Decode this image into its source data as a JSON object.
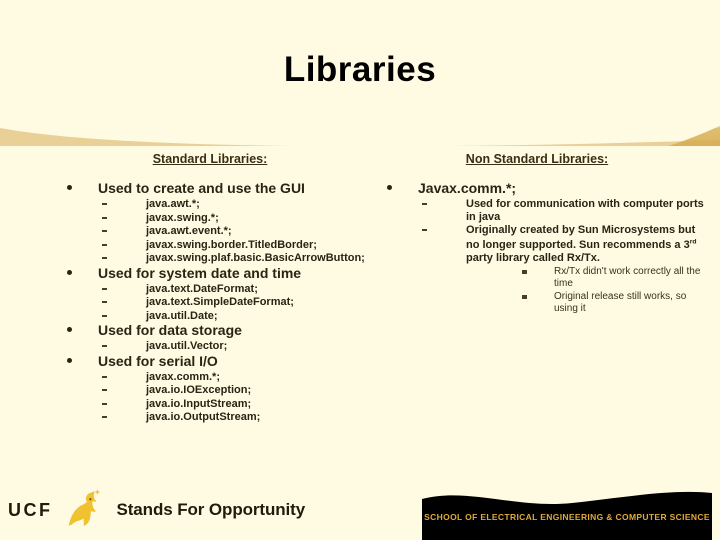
{
  "slide": {
    "title": "Libraries",
    "background_color": "#FFFBE2",
    "title_color": "#000000",
    "accent_gold": "#E8C772"
  },
  "left_column": {
    "heading": "Standard Libraries:",
    "bullets": [
      {
        "text": "Used to create and use the GUI",
        "sub": [
          "java.awt.*;",
          "javax.swing.*;",
          "java.awt.event.*;",
          "javax.swing.border.TitledBorder;",
          "javax.swing.plaf.basic.BasicArrowButton;"
        ]
      },
      {
        "text": "Used for system date and time",
        "sub": [
          "java.text.DateFormat;",
          "java.text.SimpleDateFormat;",
          "java.util.Date;"
        ]
      },
      {
        "text": "Used for data storage",
        "sub": [
          "java.util.Vector;"
        ]
      },
      {
        "text": "Used for serial I/O",
        "sub": [
          "javax.comm.*;",
          "java.io.IOException;",
          "java.io.InputStream;",
          "java.io.OutputStream;"
        ]
      }
    ]
  },
  "right_column": {
    "heading": "Non Standard Libraries:",
    "bullets": [
      {
        "text": "Javax.comm.*;",
        "sub": [
          {
            "text": "Used for communication with computer ports in java",
            "sub3": []
          },
          {
            "text_before_sup": "Originally created by Sun Microsystems but no longer supported. Sun recommends a  3",
            "sup": "rd",
            "text_after_sup": " party library called Rx/Tx.",
            "sub3": [
              "Rx/Tx didn't work correctly all the time",
              "Original release still works, so using it"
            ]
          }
        ]
      }
    ]
  },
  "footer": {
    "ucf_mark": "UCF",
    "pegasus_icon": "pegasus-logo-icon",
    "tagline": "Stands For Opportunity",
    "school_banner": "SCHOOL OF ELECTRICAL ENGINEERING & COMPUTER SCIENCE",
    "banner_text_color": "#E0A93A",
    "banner_bg_color": "#000000"
  }
}
